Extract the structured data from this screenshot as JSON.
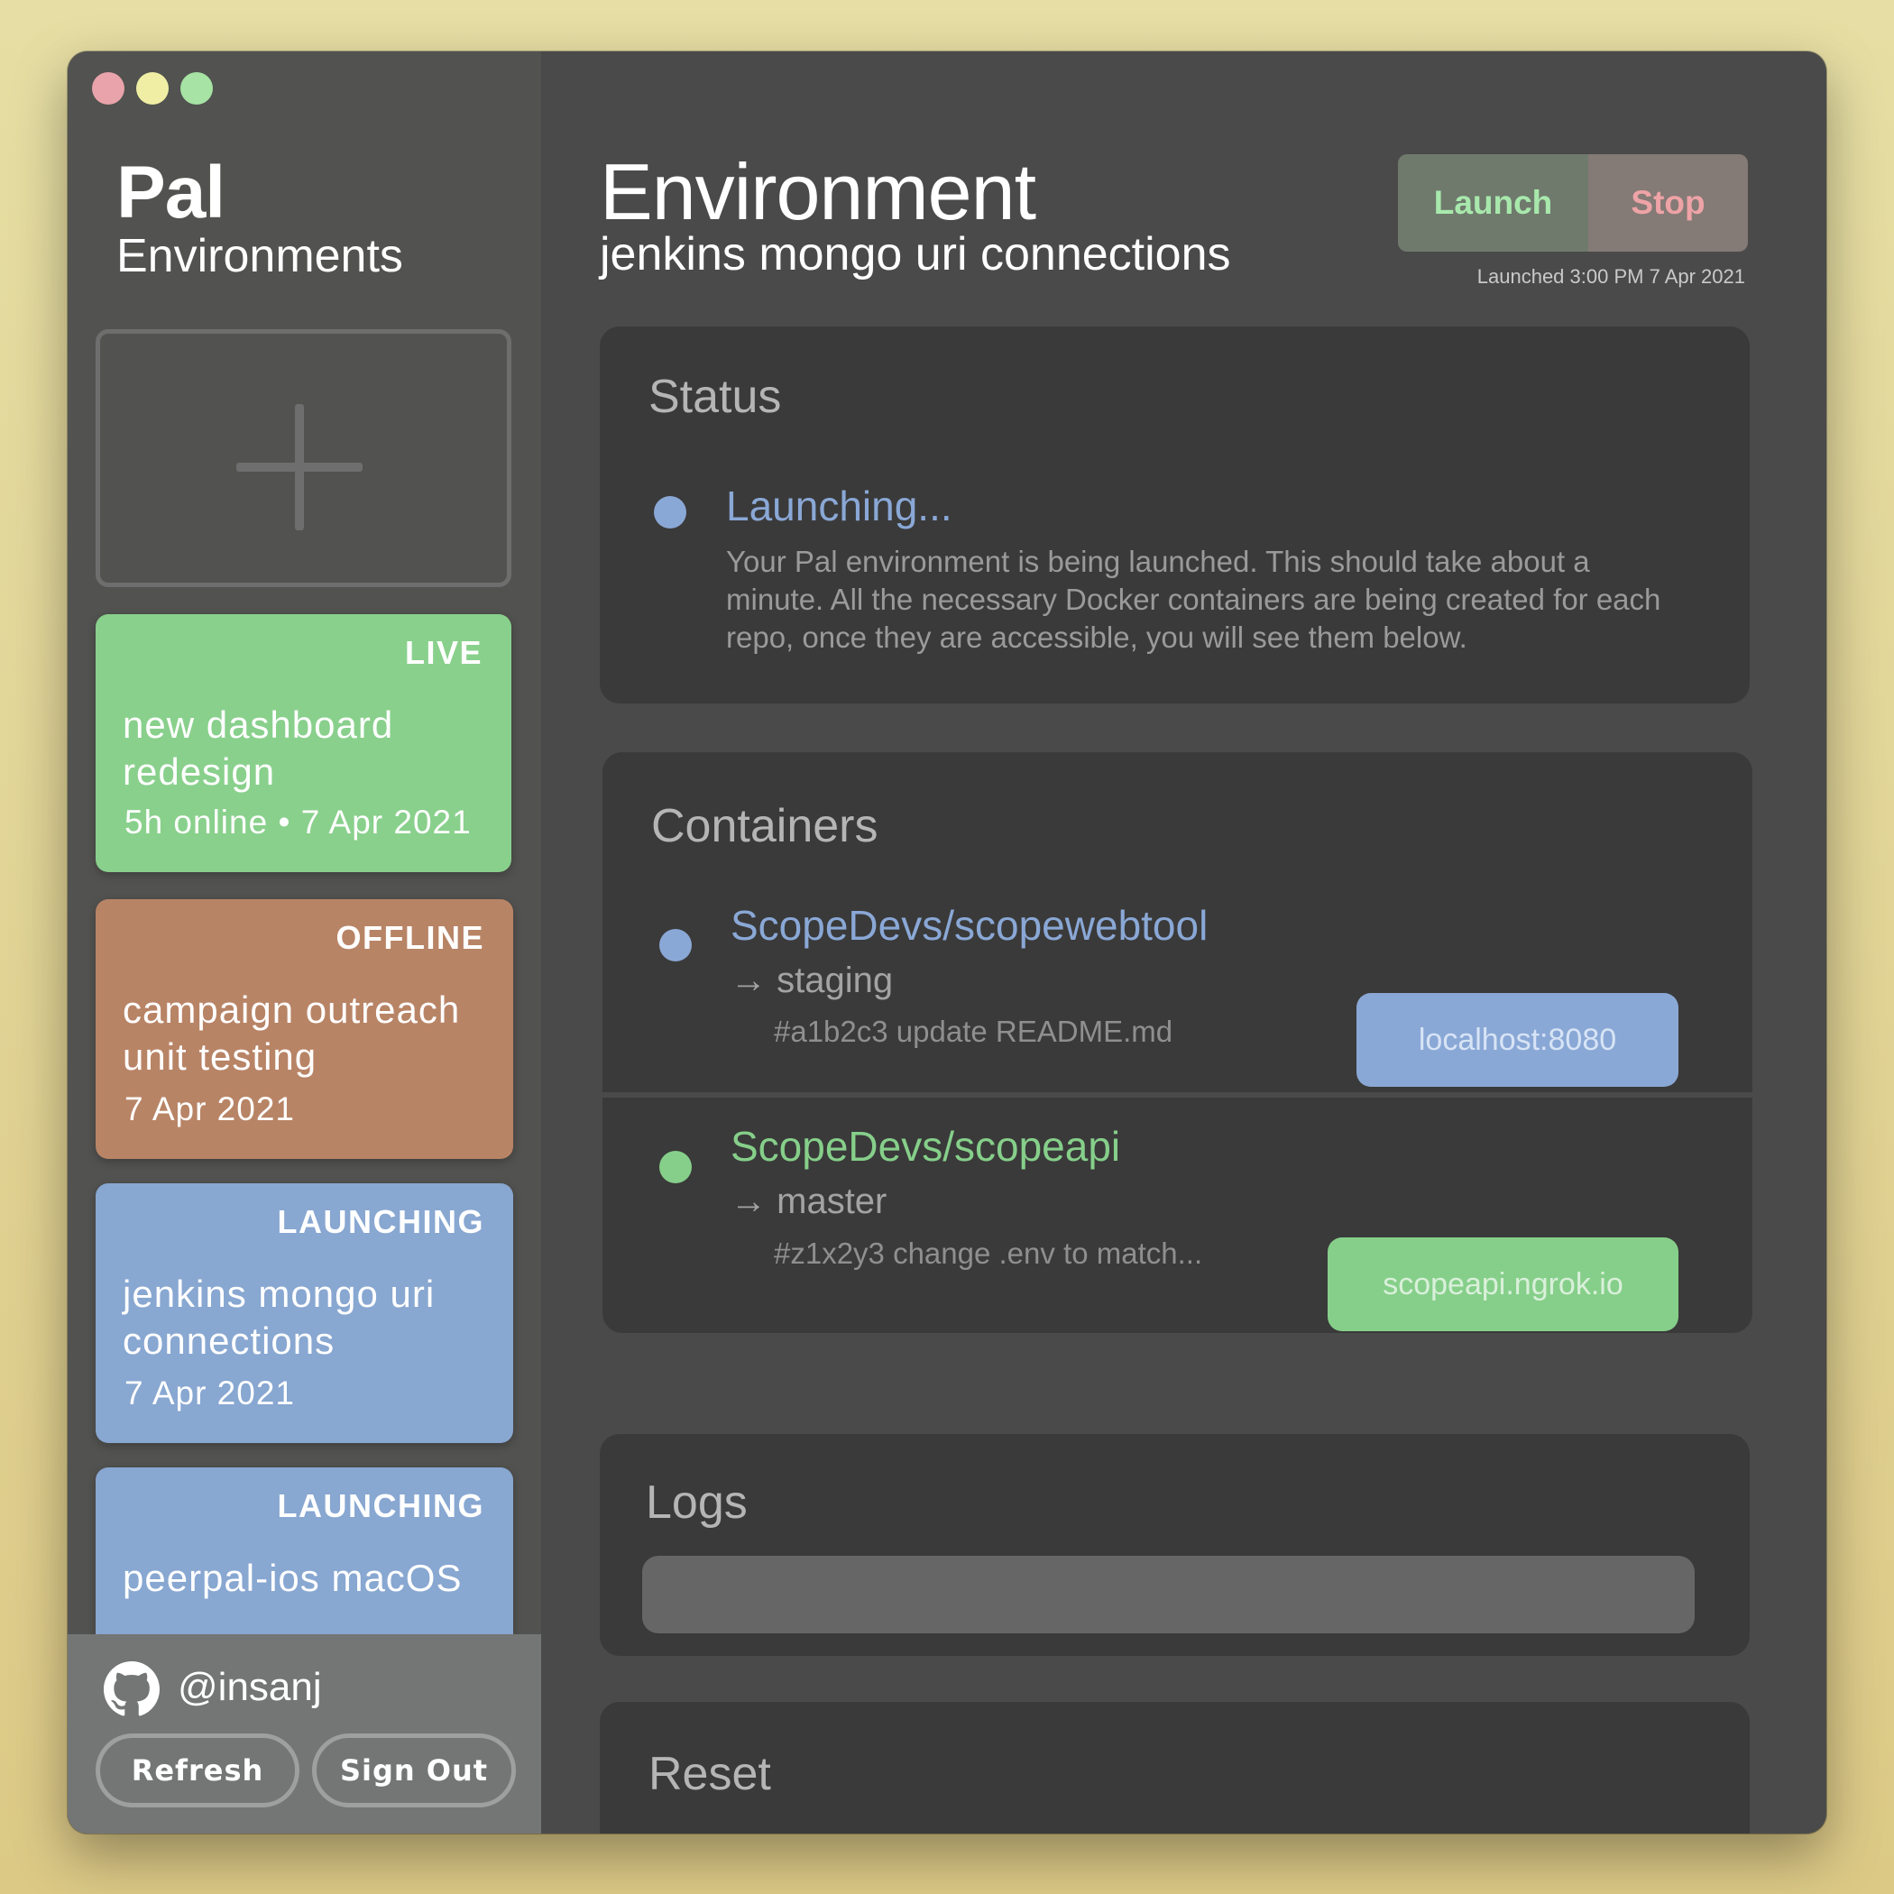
{
  "sidebar": {
    "app_title": "Pal",
    "app_subtitle": "Environments",
    "new_env_icon": "plus-icon",
    "environments": [
      {
        "status": "LIVE",
        "name": "new dashboard redesign",
        "meta": "5h online • 7 Apr 2021",
        "color": "#89d08c"
      },
      {
        "status": "OFFLINE",
        "name": "campaign outreach unit testing",
        "meta": "7 Apr 2021",
        "color": "#b88466"
      },
      {
        "status": "LAUNCHING",
        "name": "jenkins mongo uri connections",
        "meta": "7 Apr 2021",
        "color": "#88a7d1"
      },
      {
        "status": "LAUNCHING",
        "name": "peerpal-ios macOS",
        "meta": "",
        "color": "#88a7d1"
      }
    ],
    "account": {
      "icon": "github-icon",
      "handle": "@insanj",
      "refresh_label": "Refresh",
      "signout_label": "Sign Out"
    }
  },
  "header": {
    "title": "Environment",
    "subtitle": "jenkins mongo uri connections",
    "launch_label": "Launch",
    "stop_label": "Stop",
    "launched_note": "Launched  3:00 PM  7 Apr 2021"
  },
  "status": {
    "title": "Status",
    "label": "Launching...",
    "description": "Your Pal environment is being launched.  This should take about a minute. All the necessary Docker containers are being created for each repo, once they are accessible, you will see them below.",
    "color": "#8aa8d6"
  },
  "containers": {
    "title": "Containers",
    "items": [
      {
        "repo": "ScopeDevs/scopewebtool",
        "branch": "staging",
        "commit": "#a1b2c3 update README.md",
        "url": "localhost:8080",
        "color": "#8aa8d6"
      },
      {
        "repo": "ScopeDevs/scopeapi",
        "branch": "master",
        "commit": "#z1x2y3 change .env to match...",
        "url": "scopeapi.ngrok.io",
        "color": "#86cf8a"
      }
    ]
  },
  "logs": {
    "title": "Logs"
  },
  "reset": {
    "title": "Reset"
  },
  "theme": {
    "accent_green": "#89d08c",
    "accent_blue": "#88a7d1",
    "accent_orange": "#b88466",
    "panel": "#3a3a3a"
  }
}
